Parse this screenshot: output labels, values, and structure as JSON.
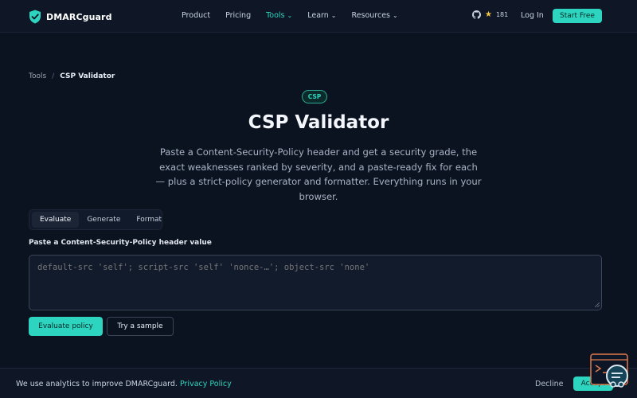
{
  "nav": {
    "brand": "DMARCguard",
    "menu": [
      {
        "label": "Product",
        "caret": false,
        "active": false
      },
      {
        "label": "Pricing",
        "caret": false,
        "active": false
      },
      {
        "label": "Tools",
        "caret": true,
        "active": true
      },
      {
        "label": "Learn",
        "caret": true,
        "active": false
      },
      {
        "label": "Resources",
        "caret": true,
        "active": false
      }
    ],
    "stars": "181",
    "login": "Log In",
    "cta": "Start Free"
  },
  "breadcrumb": {
    "parent": "Tools",
    "separator": "/",
    "current": "CSP Validator"
  },
  "hero": {
    "badge": "CSP",
    "title": "CSP Validator",
    "description": "Paste a Content-Security-Policy header and get a security grade, the exact weaknesses ranked by severity, and a paste-ready fix for each — plus a strict-policy generator and formatter. Everything runs in your browser."
  },
  "tabs": [
    {
      "label": "Evaluate",
      "active": true
    },
    {
      "label": "Generate",
      "active": false
    },
    {
      "label": "Format",
      "active": false
    }
  ],
  "form": {
    "label": "Paste a Content-Security-Policy header value",
    "placeholder": "default-src 'self'; script-src 'self' 'nonce-…'; object-src 'none'",
    "evaluate_button": "Evaluate policy",
    "sample_button": "Try a sample"
  },
  "cookie": {
    "message": "We use analytics to improve DMARCguard.",
    "link": "Privacy Policy",
    "decline": "Decline",
    "accept": "Accept"
  },
  "colors": {
    "accent": "#2dd4bf",
    "background": "#0b1220",
    "star": "#f5c542"
  }
}
